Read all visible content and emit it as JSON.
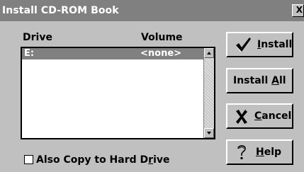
{
  "window": {
    "title": "Install CD-ROM Book",
    "close_label": "X"
  },
  "list": {
    "columns": {
      "drive": "Drive",
      "volume": "Volume"
    },
    "rows": [
      {
        "drive": "E:",
        "volume": "<none>",
        "selected": true
      }
    ]
  },
  "buttons": {
    "install": {
      "label": "Install",
      "mnemonic": "I",
      "rest": "nstall",
      "icon": "checkmark-icon"
    },
    "install_all": {
      "label": "Install All",
      "prefix": "Install ",
      "mnemonic": "A",
      "rest": "ll"
    },
    "cancel": {
      "label": "Cancel",
      "mnemonic": "C",
      "rest": "ancel",
      "icon": "x-mark-icon"
    },
    "help": {
      "label": "Help",
      "mnemonic": "H",
      "rest": "elp",
      "icon": "question-mark-icon"
    }
  },
  "options": {
    "copy_to_hard_drive": {
      "label": "Also Copy to Hard Drive",
      "prefix": "Also Copy to Hard D",
      "mnemonic": "r",
      "rest": "ive",
      "checked": false
    }
  },
  "colors": {
    "titlebar": "#808080",
    "dialog": "#c0c0c0",
    "selection": "#808080"
  }
}
